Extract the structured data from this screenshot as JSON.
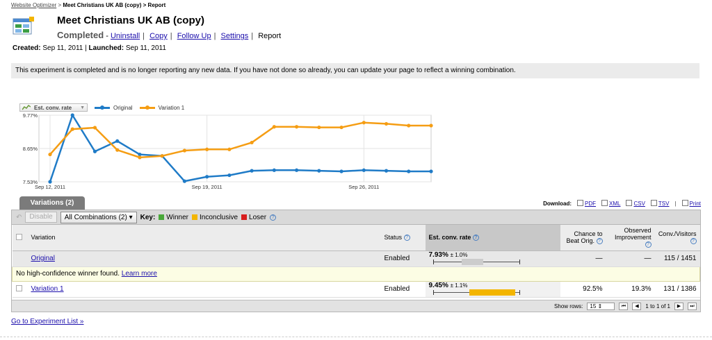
{
  "breadcrumb": {
    "root": "Website Optimizer",
    "sep": ">",
    "experiment": "Meet Christians UK AB (copy)",
    "page": "Report"
  },
  "title": "Meet Christians UK AB (copy)",
  "status": {
    "state": "Completed",
    "dash": "-",
    "links": [
      "Uninstall",
      "Copy",
      "Follow Up",
      "Settings"
    ],
    "current": "Report"
  },
  "dates": {
    "created_label": "Created:",
    "created": "Sep 11, 2011",
    "launched_label": "Launched:",
    "launched": "Sep 11, 2011",
    "sep": "|"
  },
  "notice": "This experiment is completed and is no longer reporting any new data. If you have not done so already, you can update your page to reflect a winning combination.",
  "chart_toolbar": {
    "metric": "Est. conv. rate"
  },
  "chart_data": {
    "type": "line",
    "title": "",
    "x": [
      "Sep 12",
      "Sep 13",
      "Sep 14",
      "Sep 15",
      "Sep 16",
      "Sep 17",
      "Sep 18",
      "Sep 19",
      "Sep 20",
      "Sep 21",
      "Sep 22",
      "Sep 23",
      "Sep 24",
      "Sep 25",
      "Sep 26",
      "Sep 27",
      "Sep 28",
      "Sep 29"
    ],
    "x_ticks": [
      "Sep 12, 2011",
      "Sep 19, 2011",
      "Sep 26, 2011"
    ],
    "x_tick_index": [
      0,
      7,
      14
    ],
    "y_ticks": [
      "9.77%",
      "8.65%",
      "7.53%"
    ],
    "ylim": [
      7.53,
      9.77
    ],
    "xlabel": "",
    "ylabel": "",
    "grid": true,
    "legend": "top-left",
    "series": [
      {
        "name": "Original",
        "color": "#1f7bc7",
        "values": [
          7.53,
          9.77,
          8.55,
          8.9,
          8.45,
          8.4,
          7.55,
          7.7,
          7.75,
          7.9,
          7.92,
          7.92,
          7.9,
          7.88,
          7.92,
          7.9,
          7.88,
          7.88
        ]
      },
      {
        "name": "Variation 1",
        "color": "#f59d13",
        "values": [
          8.45,
          9.3,
          9.35,
          8.6,
          8.35,
          8.4,
          8.58,
          8.62,
          8.62,
          8.85,
          9.38,
          9.38,
          9.36,
          9.36,
          9.52,
          9.48,
          9.42,
          9.42
        ]
      }
    ]
  },
  "tabs": {
    "variations": "Variations (2)"
  },
  "downloads": {
    "label": "Download:",
    "items": [
      "PDF",
      "XML",
      "CSV",
      "TSV"
    ],
    "print": "Print",
    "sep": "|"
  },
  "table_toolbar": {
    "disable": "Disable",
    "combinations": "All Combinations (2)",
    "key_label": "Key:",
    "keys": [
      {
        "label": "Winner",
        "color": "#49a83a"
      },
      {
        "label": "Inconclusive",
        "color": "#f3b500"
      },
      {
        "label": "Loser",
        "color": "#d81e1e"
      }
    ]
  },
  "table": {
    "headers": {
      "variation": "Variation",
      "status": "Status",
      "rate": "Est. conv. rate",
      "chance": [
        "Chance to",
        "Beat Orig."
      ],
      "improvement": [
        "Observed",
        "Improvement"
      ],
      "conv": "Conv./Visitors"
    },
    "rows": [
      {
        "name": "Original",
        "status": "Enabled",
        "rate": "7.93%",
        "ci": "± 1.0%",
        "chance": "—",
        "improvement": "—",
        "conv": "115 / 1451",
        "bar_lo": 0.33,
        "bar_hi": 0.58
      },
      {
        "name": "Variation 1",
        "status": "Enabled",
        "rate": "9.45%",
        "ci": "± 1.1%",
        "chance": "92.5%",
        "improvement": "19.3%",
        "conv": "131 / 1386",
        "bar_lo": 0.42,
        "bar_hi": 0.95
      }
    ],
    "no_winner": "No high-confidence winner found.",
    "learn_more": "Learn more"
  },
  "footer": {
    "show_rows": "Show rows:",
    "rows_value": "15",
    "range": "1 to 1 of 1"
  },
  "back_link": "Go to Experiment List »"
}
